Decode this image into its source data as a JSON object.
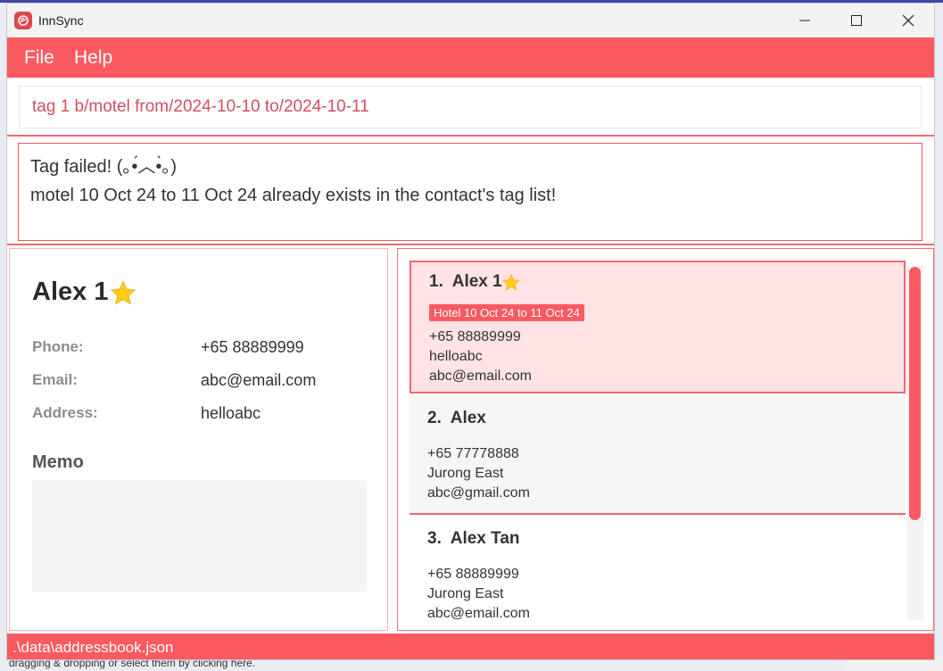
{
  "window": {
    "title": "InnSync",
    "accent": "#fb5a61"
  },
  "menu": {
    "items": [
      "File",
      "Help"
    ]
  },
  "command": {
    "value": "tag 1 b/motel from/2024-10-10 to/2024-10-11"
  },
  "result": {
    "line1": "Tag failed! (｡•́︿•̀｡)",
    "line2": "motel 10 Oct 24 to 11 Oct 24 already exists in the contact's tag list!"
  },
  "detail": {
    "name": "Alex 1",
    "starred": true,
    "phone_label": "Phone:",
    "phone": "+65 88889999",
    "email_label": "Email:",
    "email": "abc@email.com",
    "address_label": "Address:",
    "address": "helloabc",
    "memo_label": "Memo"
  },
  "contacts": [
    {
      "index": "1.",
      "name": "Alex 1",
      "starred": true,
      "tag": "Hotel 10 Oct 24 to 11 Oct 24",
      "phone": "+65 88889999",
      "address": "helloabc",
      "email": "abc@email.com"
    },
    {
      "index": "2.",
      "name": "Alex",
      "starred": false,
      "phone": "+65 77778888",
      "address": "Jurong East",
      "email": "abc@gmail.com"
    },
    {
      "index": "3.",
      "name": "Alex Tan",
      "starred": false,
      "phone": "+65 88889999",
      "address": "Jurong East",
      "email": "abc@email.com"
    }
  ],
  "status": {
    "path": ".\\data\\addressbook.json"
  },
  "background": {
    "bottom_text": "dragging & dropping or select them by clicking here."
  }
}
